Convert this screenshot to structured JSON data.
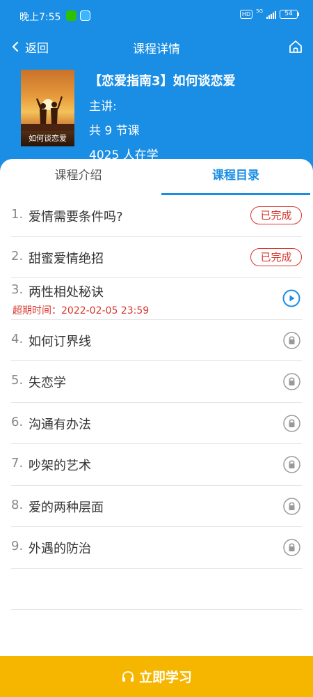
{
  "status_bar": {
    "time": "晚上7:55",
    "network_badge": "HD",
    "signal_label": "5G",
    "battery": "54"
  },
  "nav": {
    "back_label": "返回",
    "title": "课程详情"
  },
  "course": {
    "cover_text": "如何谈恋爱",
    "title": "【恋爱指南3】如何谈恋爱",
    "lecturer": "主讲:",
    "lesson_count": "共 9 节课",
    "learners": "4025 人在学"
  },
  "tabs": [
    {
      "label": "课程介绍",
      "active": false
    },
    {
      "label": "课程目录",
      "active": true
    }
  ],
  "lessons": [
    {
      "num": "1.",
      "title": "爱情需要条件吗?",
      "status": "done",
      "badge": "已完成"
    },
    {
      "num": "2.",
      "title": "甜蜜爱情绝招",
      "status": "done",
      "badge": "已完成"
    },
    {
      "num": "3.",
      "title": "两性相处秘诀",
      "status": "current",
      "expire": "超期时间：2022-02-05 23:59"
    },
    {
      "num": "4.",
      "title": "如何订界线",
      "status": "locked"
    },
    {
      "num": "5.",
      "title": "失恋学",
      "status": "locked"
    },
    {
      "num": "6.",
      "title": "沟通有办法",
      "status": "locked"
    },
    {
      "num": "7.",
      "title": "吵架的艺术",
      "status": "locked"
    },
    {
      "num": "8.",
      "title": "爱的两种层面",
      "status": "locked"
    },
    {
      "num": "9.",
      "title": "外遇的防治",
      "status": "locked"
    }
  ],
  "cta": {
    "label": "立即学习",
    "icon": "headphones-icon"
  },
  "colors": {
    "primary": "#1a8ee5",
    "done_red": "#d7362d",
    "cta_yellow": "#f6b600"
  }
}
